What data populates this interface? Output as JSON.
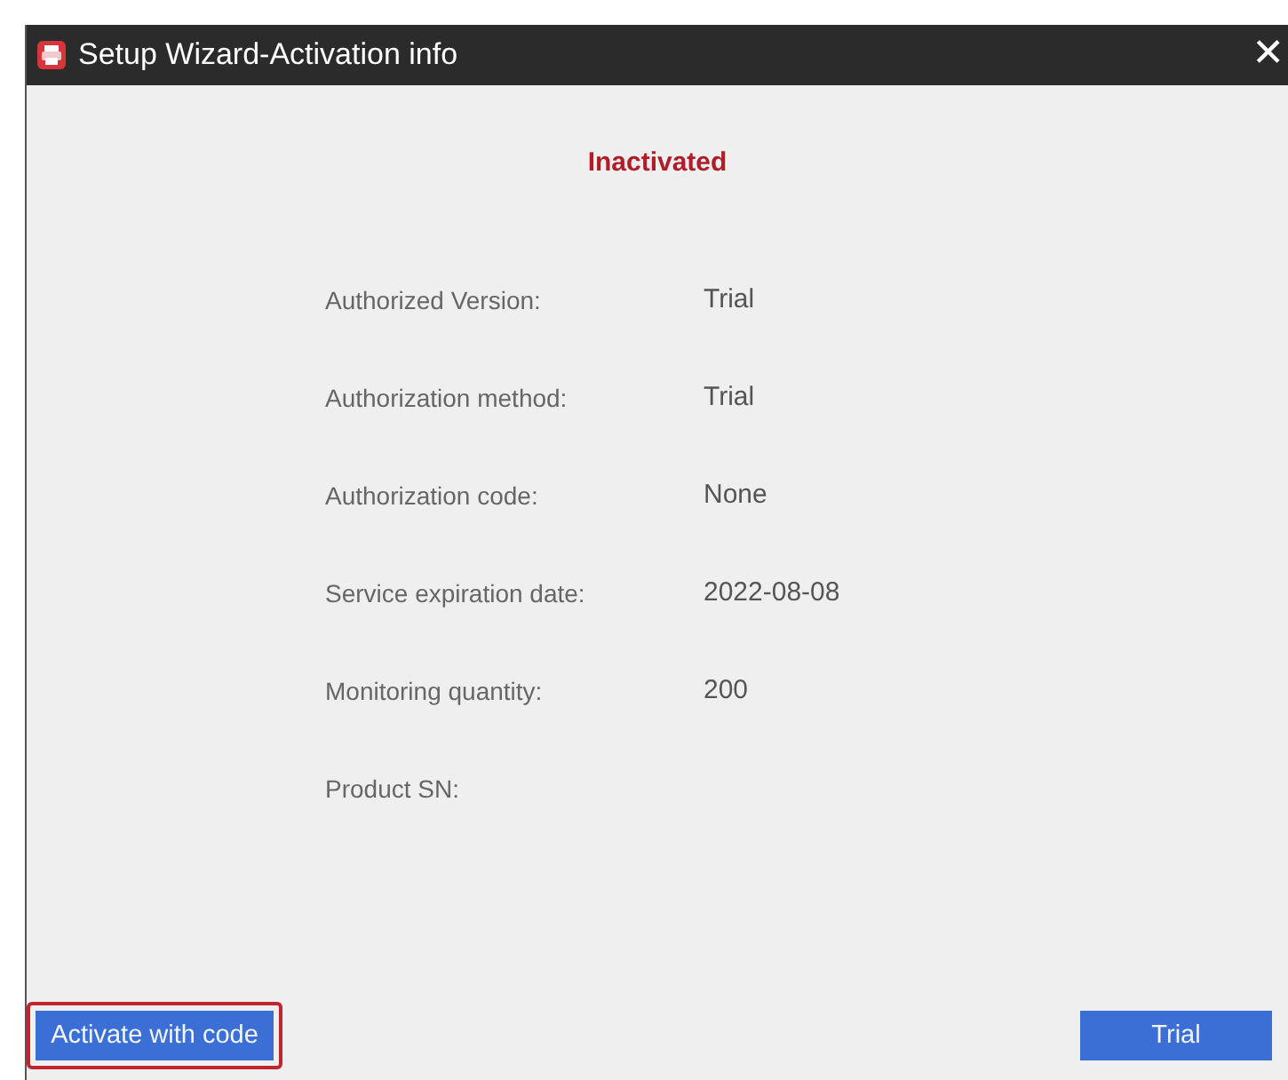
{
  "window": {
    "title": "Setup Wizard-Activation info",
    "close": "✕"
  },
  "status": {
    "text": "Inactivated",
    "kind": "inactive"
  },
  "info_rows": [
    {
      "label": "Authorized Version:",
      "value": "Trial"
    },
    {
      "label": "Authorization method:",
      "value": "Trial"
    },
    {
      "label": "Authorization code:",
      "value": "None"
    },
    {
      "label": "Service expiration date:",
      "value": "2022-08-08"
    },
    {
      "label": "Monitoring quantity:",
      "value": "200"
    },
    {
      "label": "Product SN:"
    }
  ],
  "buttons": [
    {
      "label": "Activate with code",
      "highlighted": true
    },
    {
      "label": "Trial",
      "highlighted": false
    }
  ]
}
